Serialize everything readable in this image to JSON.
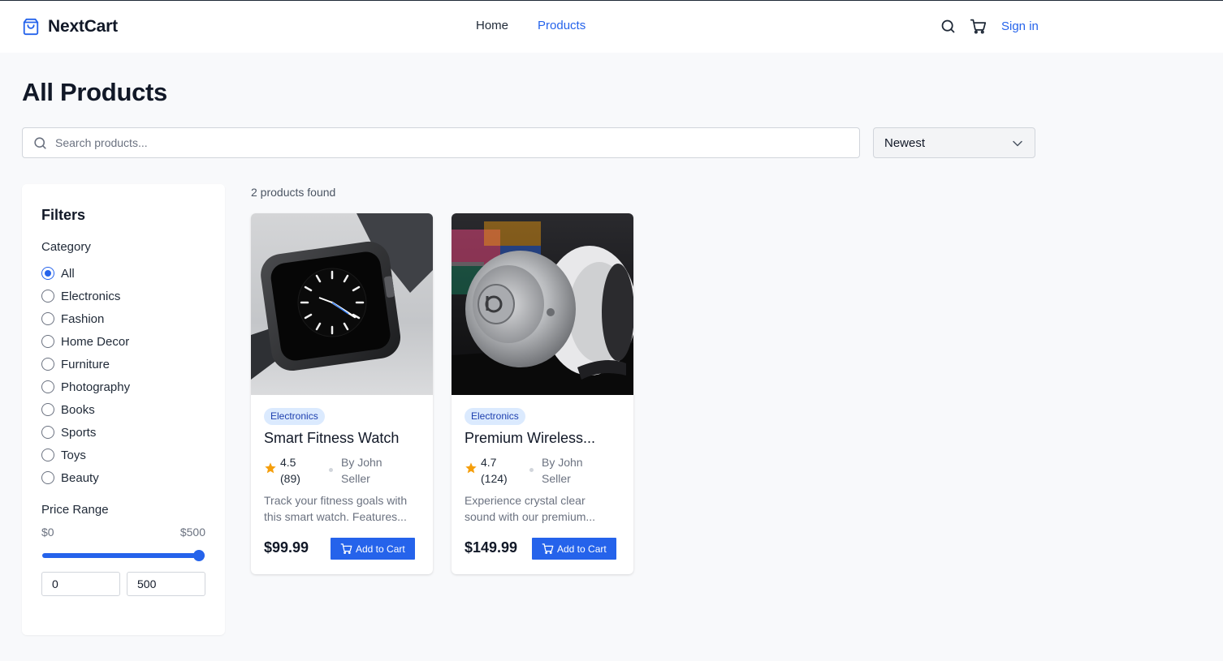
{
  "brand": {
    "name": "NextCart"
  },
  "nav": {
    "home": "Home",
    "products": "Products"
  },
  "header": {
    "signin": "Sign in"
  },
  "page": {
    "title": "All Products"
  },
  "search": {
    "placeholder": "Search products...",
    "value": ""
  },
  "sort": {
    "selected": "Newest"
  },
  "filters": {
    "title": "Filters",
    "category_label": "Category",
    "categories": [
      "All",
      "Electronics",
      "Fashion",
      "Home Decor",
      "Furniture",
      "Photography",
      "Books",
      "Sports",
      "Toys",
      "Beauty"
    ],
    "selected_category": "All",
    "price_label": "Price Range",
    "price_min_label": "$0",
    "price_max_label": "$500",
    "price_min": "0",
    "price_max": "500",
    "slider_fraction": 1.0
  },
  "results": {
    "count_text": "2 products found"
  },
  "products": [
    {
      "category": "Electronics",
      "title": "Smart Fitness Watch",
      "rating": "4.5",
      "reviews": "(89)",
      "seller_line1": "By John",
      "seller_line2": "Seller",
      "desc_line1": "Track your fitness goals with",
      "desc_line2": "this smart watch. Features...",
      "price": "$99.99",
      "button": "Add to Cart"
    },
    {
      "category": "Electronics",
      "title": "Premium Wireless...",
      "rating": "4.7",
      "reviews": "(124)",
      "seller_line1": "By John",
      "seller_line2": "Seller",
      "desc_line1": "Experience crystal clear",
      "desc_line2": "sound with our premium...",
      "price": "$149.99",
      "button": "Add to Cart"
    }
  ],
  "colors": {
    "accent": "#2563eb",
    "badge_bg": "#dbeafe",
    "badge_text": "#1e40af",
    "star": "#f59e0b"
  },
  "icons": [
    "shopping-bag-icon",
    "search-icon",
    "cart-icon",
    "chevron-down-icon",
    "star-icon"
  ]
}
